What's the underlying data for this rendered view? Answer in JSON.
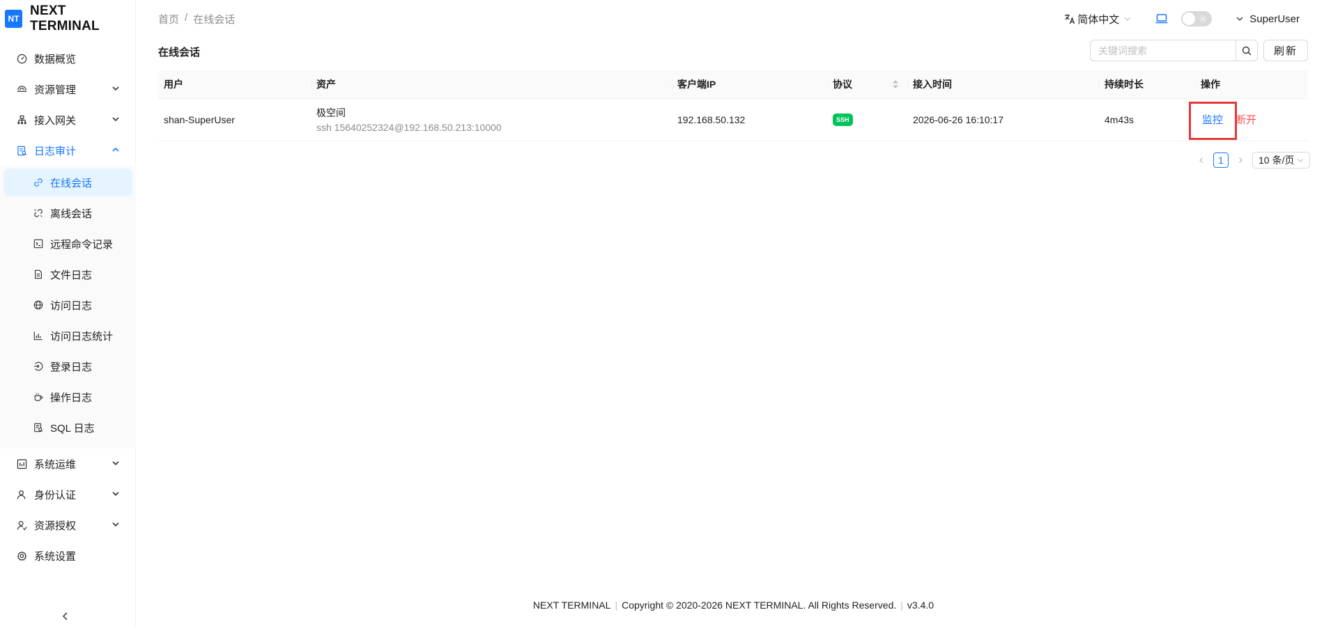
{
  "brand": {
    "logo": "NT",
    "name": "NEXT TERMINAL"
  },
  "sidebar": {
    "items": [
      {
        "label": "数据概览",
        "icon": "dashboard-icon"
      },
      {
        "label": "资源管理",
        "icon": "resource-icon"
      },
      {
        "label": "接入网关",
        "icon": "gateway-icon"
      },
      {
        "label": "日志审计",
        "icon": "audit-icon"
      },
      {
        "label": "系统运维",
        "icon": "ops-icon"
      },
      {
        "label": "身份认证",
        "icon": "identity-icon"
      },
      {
        "label": "资源授权",
        "icon": "authorization-icon"
      },
      {
        "label": "系统设置",
        "icon": "settings-icon"
      }
    ],
    "audit_sub": [
      {
        "label": "在线会话",
        "icon": "link-icon"
      },
      {
        "label": "离线会话",
        "icon": "unlink-icon"
      },
      {
        "label": "远程命令记录",
        "icon": "terminal-icon"
      },
      {
        "label": "文件日志",
        "icon": "file-icon"
      },
      {
        "label": "访问日志",
        "icon": "globe-icon"
      },
      {
        "label": "访问日志统计",
        "icon": "bar-chart-icon"
      },
      {
        "label": "登录日志",
        "icon": "login-icon"
      },
      {
        "label": "操作日志",
        "icon": "coffee-icon"
      },
      {
        "label": "SQL 日志",
        "icon": "sql-file-icon"
      }
    ]
  },
  "breadcrumb": {
    "home": "首页",
    "sep": "/",
    "current": "在线会话"
  },
  "header": {
    "language": "简体中文",
    "user": "SuperUser"
  },
  "page": {
    "title": "在线会话",
    "search_placeholder": "关键词搜索",
    "refresh": "刷新"
  },
  "table": {
    "columns": [
      "用户",
      "资产",
      "客户端IP",
      "协议",
      "接入时间",
      "持续时长",
      "操作"
    ],
    "rows": [
      {
        "user": "shan-SuperUser",
        "asset_name": "极空间",
        "asset_detail": "ssh 15640252324@192.168.50.213:10000",
        "client_ip": "192.168.50.132",
        "protocol": "SSH",
        "access_time": "2026-06-26 16:10:17",
        "duration": "4m43s",
        "op_monitor": "监控",
        "op_disconnect": "断开"
      }
    ]
  },
  "pagination": {
    "current": "1",
    "page_size": "10 条/页"
  },
  "footer": {
    "name": "NEXT TERMINAL",
    "copyright": "Copyright © 2020-2026 NEXT TERMINAL. All Rights Reserved.",
    "version": "v3.4.0"
  },
  "colors": {
    "primary": "#1677ff",
    "danger": "#ff4d4f",
    "ssh_tag": "#00c35a",
    "highlight": "#e53935"
  }
}
